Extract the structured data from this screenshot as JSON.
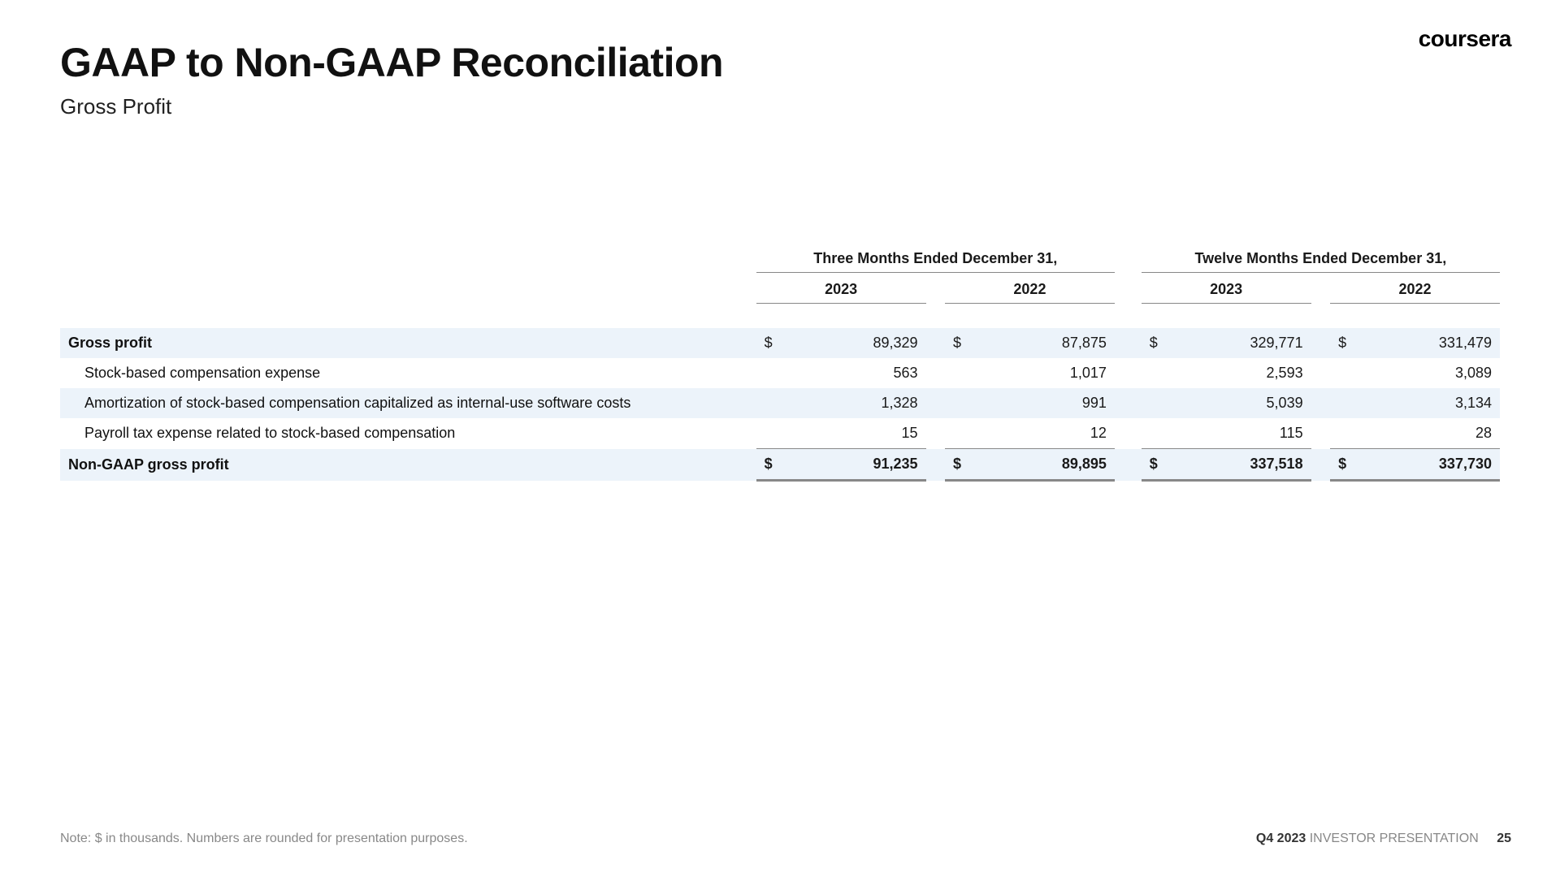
{
  "logo": "coursera",
  "title": "GAAP to Non-GAAP Reconciliation",
  "subtitle": "Gross Profit",
  "periods": {
    "three": "Three Months Ended December 31,",
    "twelve": "Twelve Months Ended December 31,"
  },
  "years": {
    "y1": "2023",
    "y2": "2022",
    "y3": "2023",
    "y4": "2022"
  },
  "currency": "$",
  "rows": {
    "gross_profit": {
      "label": "Gross profit",
      "v1": "89,329",
      "v2": "87,875",
      "v3": "329,771",
      "v4": "331,479"
    },
    "sbc": {
      "label": "Stock-based compensation expense",
      "v1": "563",
      "v2": "1,017",
      "v3": "2,593",
      "v4": "3,089"
    },
    "amort": {
      "label": "Amortization of stock-based compensation capitalized as internal-use software costs",
      "v1": "1,328",
      "v2": "991",
      "v3": "5,039",
      "v4": "3,134"
    },
    "payroll": {
      "label": "Payroll tax expense related to stock-based compensation",
      "v1": "15",
      "v2": "12",
      "v3": "115",
      "v4": "28"
    },
    "nongaap": {
      "label": "Non-GAAP gross profit",
      "v1": "91,235",
      "v2": "89,895",
      "v3": "337,518",
      "v4": "337,730"
    }
  },
  "note": "Note: $ in thousands. Numbers are rounded for presentation purposes.",
  "footer": {
    "left": "Q4 2023",
    "right": "INVESTOR PRESENTATION",
    "page": "25"
  },
  "chart_data": {
    "type": "table",
    "title": "GAAP to Non-GAAP Reconciliation — Gross Profit",
    "unit": "USD thousands",
    "columns": [
      "Three Months Ended Dec 31 2023",
      "Three Months Ended Dec 31 2022",
      "Twelve Months Ended Dec 31 2023",
      "Twelve Months Ended Dec 31 2022"
    ],
    "rows": [
      {
        "label": "Gross profit",
        "values": [
          89329,
          87875,
          329771,
          331479
        ]
      },
      {
        "label": "Stock-based compensation expense",
        "values": [
          563,
          1017,
          2593,
          3089
        ]
      },
      {
        "label": "Amortization of stock-based compensation capitalized as internal-use software costs",
        "values": [
          1328,
          991,
          5039,
          3134
        ]
      },
      {
        "label": "Payroll tax expense related to stock-based compensation",
        "values": [
          15,
          12,
          115,
          28
        ]
      },
      {
        "label": "Non-GAAP gross profit",
        "values": [
          91235,
          89895,
          337518,
          337730
        ]
      }
    ]
  }
}
